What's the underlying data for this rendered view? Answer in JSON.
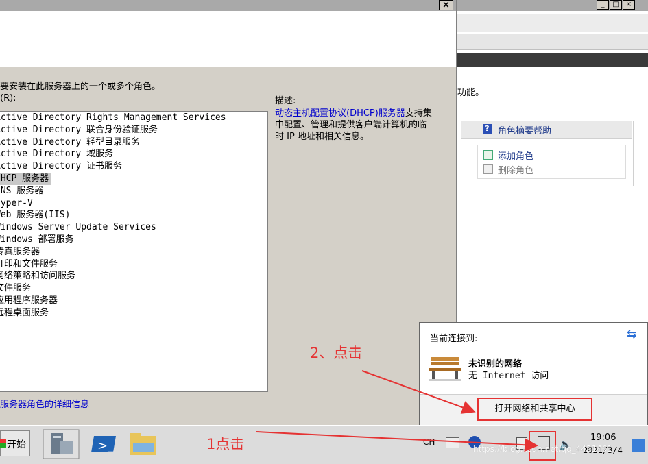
{
  "wizard": {
    "close": "×",
    "instruction": "要安装在此服务器上的一个或多个角色。",
    "roles_label": "(R):",
    "roles": [
      "Active Directory Rights Management Services",
      "Active Directory 联合身份验证服务",
      "Active Directory 轻型目录服务",
      "Active Directory 域服务",
      "Active Directory 证书服务",
      "DHCP 服务器",
      "DNS 服务器",
      "Hyper-V",
      "Web 服务器(IIS)",
      "Windows Server Update Services",
      "Windows 部署服务",
      "传真服务器",
      "打印和文件服务",
      "网络策略和访问服务",
      "文件服务",
      "应用程序服务器",
      "远程桌面服务"
    ],
    "selected_index": 5,
    "description_label": "描述:",
    "description_link": "动态主机配置协议(DHCP)服务器",
    "description_text": "支持集中配置、管理和提供客户端计算机的临时 IP 地址和相关信息。",
    "more_info_link": "服务器角色的详细信息"
  },
  "server_manager": {
    "buttons": [
      "_",
      "□",
      "×"
    ],
    "func_text": "功能。",
    "help_label": "角色摘要帮助",
    "add_role": "添加角色",
    "remove_role": "删除角色"
  },
  "network_popup": {
    "connected_to": "当前连接到:",
    "network_name": "未识别的网络",
    "access": "无 Internet 访问",
    "open_center": "打开网络和共享中心"
  },
  "taskbar": {
    "start_label": "开始",
    "lang": "CH",
    "time": "19:06",
    "date": "2021/3/4",
    "watermark": "https://blog.csdn.net/qq_4421461"
  },
  "annotations": {
    "step2": "2、点击",
    "step1": "1点击"
  },
  "colors": {
    "annotation_red": "#e53333",
    "link_blue": "#0000cc"
  }
}
